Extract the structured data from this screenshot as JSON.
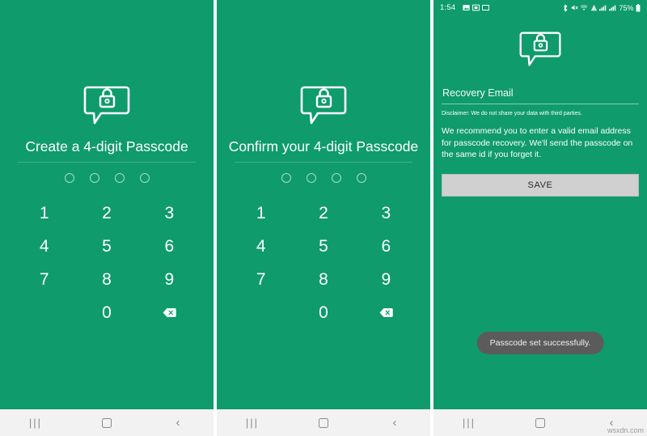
{
  "app": {
    "brand_green": "#0f9b6c",
    "logo_icon": "chat-lock-icon"
  },
  "statusbar": {
    "time": "1:54",
    "battery_text": "75%",
    "left_icons": [
      "gallery-icon",
      "screenshot-icon",
      "screen-icon"
    ],
    "right_icons": [
      "bluetooth-icon",
      "mute-icon",
      "wifi-icon",
      "data-icon",
      "signal-icon",
      "signal-2-icon"
    ]
  },
  "screen1": {
    "title": "Create a 4-digit Passcode",
    "dots": 4,
    "keys": [
      "1",
      "2",
      "3",
      "4",
      "5",
      "6",
      "7",
      "8",
      "9",
      "",
      "0",
      "backspace"
    ]
  },
  "screen2": {
    "title": "Confirm your 4-digit Passcode",
    "dots": 4,
    "keys": [
      "1",
      "2",
      "3",
      "4",
      "5",
      "6",
      "7",
      "8",
      "9",
      "",
      "0",
      "backspace"
    ]
  },
  "screen3": {
    "email_placeholder": "Recovery Email",
    "email_value": "",
    "disclaimer": "Disclaimer: We do not share your data with third parties.",
    "recommendation": "We recommend you to enter a valid email address for passcode recovery. We'll send the passcode on the same id if you forget it.",
    "save_label": "SAVE",
    "toast": "Passcode set successfully."
  },
  "navbar": {
    "recents_label": "|||",
    "home_label": "home-square-icon",
    "back_label": "‹"
  },
  "watermark": "wsxdn.com"
}
